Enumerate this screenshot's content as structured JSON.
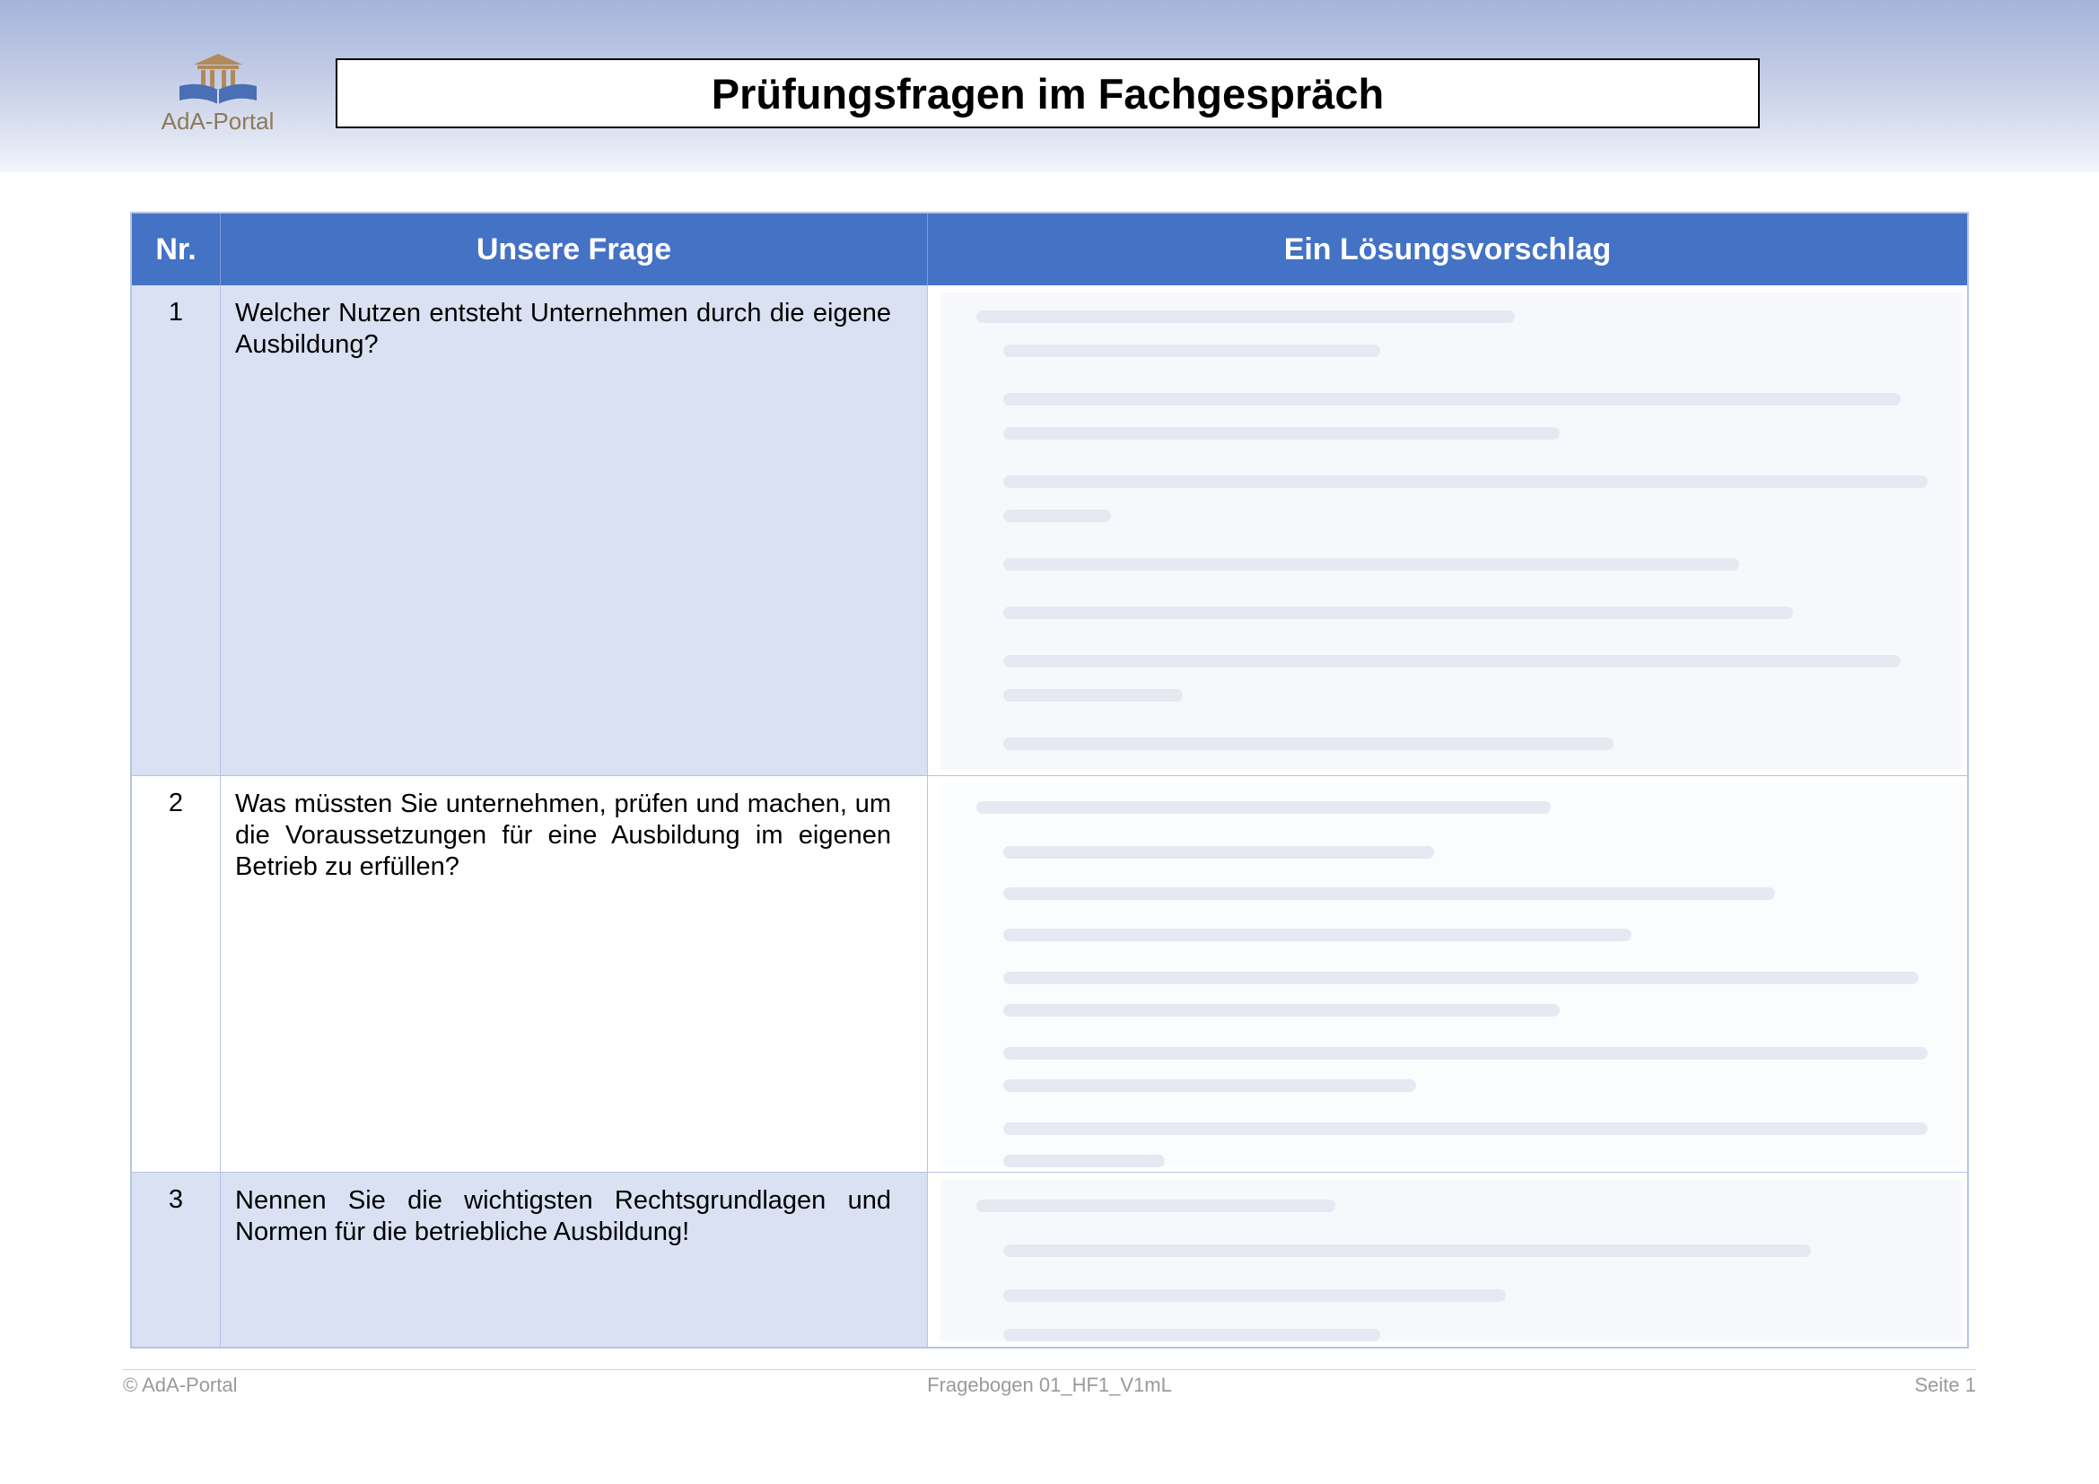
{
  "header": {
    "logo_text": "AdA-Portal",
    "title": "Prüfungsfragen im Fachgespräch"
  },
  "table": {
    "columns": [
      "Nr.",
      "Unsere Frage",
      "Ein Lösungsvorschlag"
    ],
    "rows": [
      {
        "nr": "1",
        "frage": "Welcher Nutzen entsteht Unternehmen durch die eigene Ausbildung?"
      },
      {
        "nr": "2",
        "frage": "Was müssten Sie unternehmen, prüfen und machen, um die Voraussetzungen für eine Ausbildung im eigenen Betrieb zu erfüllen?"
      },
      {
        "nr": "3",
        "frage": "Nennen Sie die wichtigsten Rechtsgrundlagen und Normen für die betriebliche Ausbildung!"
      }
    ]
  },
  "footer": {
    "left": "© AdA-Portal",
    "center": "Fragebogen 01_HF1_V1mL",
    "right": "Seite 1"
  }
}
